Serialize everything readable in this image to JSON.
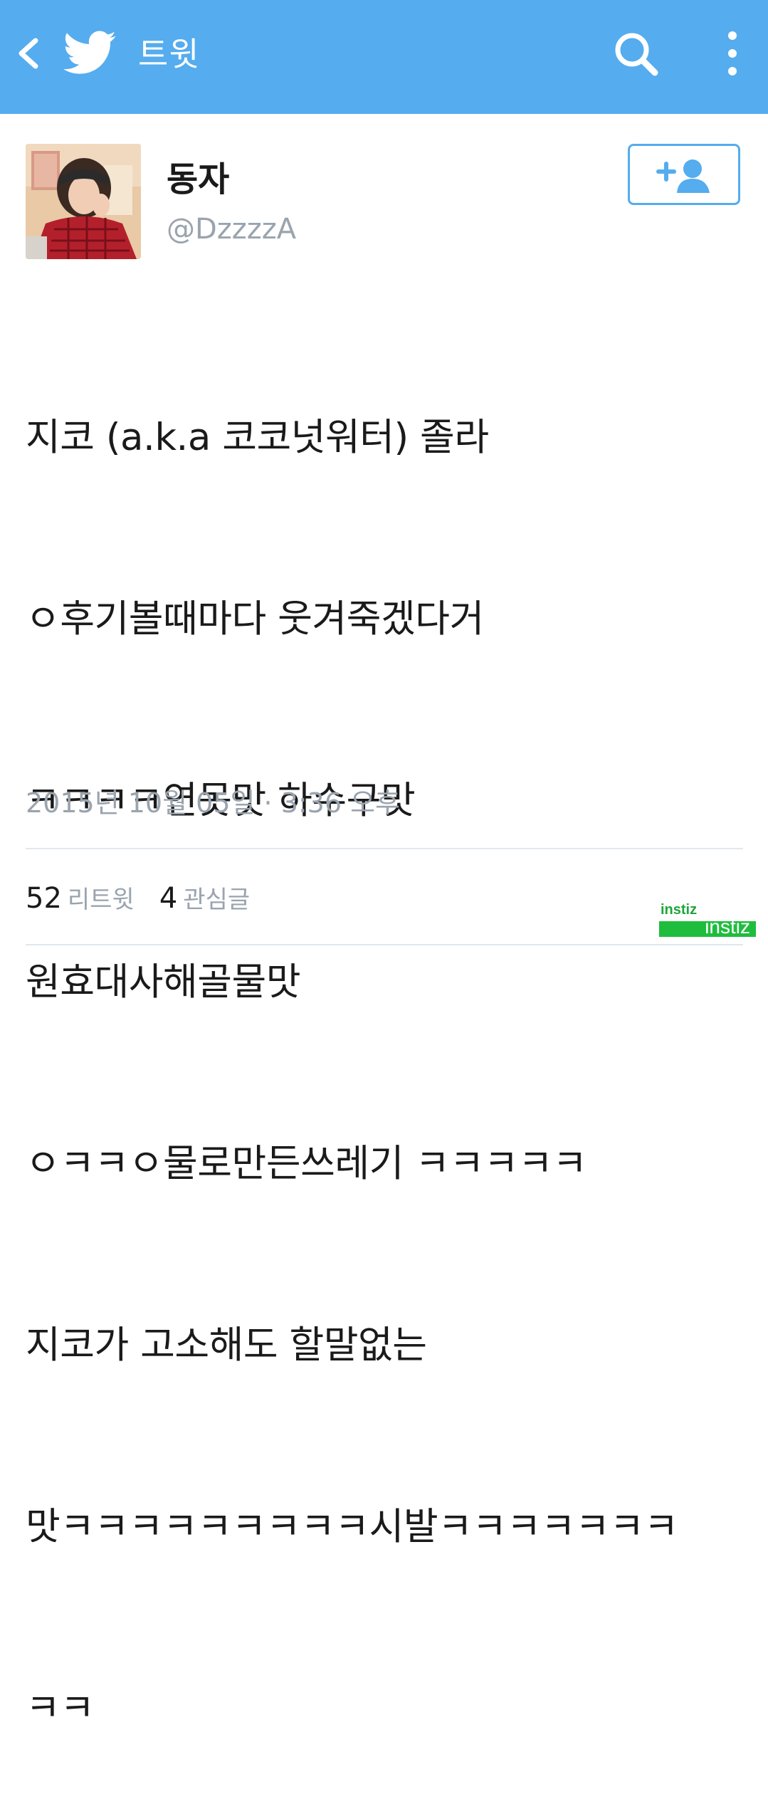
{
  "colors": {
    "header_bg": "#55acee",
    "accent": "#55acee",
    "muted_text": "#9aa4ae",
    "watermark": "#1fbd3d"
  },
  "header": {
    "title": "트윗",
    "icons": [
      "back-icon",
      "twitter-bird-icon",
      "search-icon",
      "more-vert-icon"
    ]
  },
  "user": {
    "display_name": "동자",
    "handle": "@DzzzzA",
    "follow_icon": "add-user-icon"
  },
  "tweet": {
    "lines": [
      "지코 (a.k.a 코코넛워터) 졸라",
      "ㅇ후기볼때마다 웃겨죽겠다거",
      "ㅋㅋㅋㅋ연못맛 하수구맛",
      "원효대사해골물맛",
      "ㅇㅋㅋㅇ물로만든쓰레기 ㅋㅋㅋㅋㅋ",
      "지코가 고소해도 할말없는",
      "맛ㅋㅋㅋㅋㅋㅋㅋㅋㅋ시발ㅋㅋㅋㅋㅋㅋㅋ",
      "ㅋㅋ"
    ],
    "timestamp": "2015년 10월 05일 · 3:36 오후"
  },
  "stats": {
    "retweets": {
      "count": "52",
      "label": "리트윗"
    },
    "likes": {
      "count": "4",
      "label": "관심글"
    }
  },
  "watermark": {
    "top": "instiz",
    "bottom": "instiz"
  }
}
